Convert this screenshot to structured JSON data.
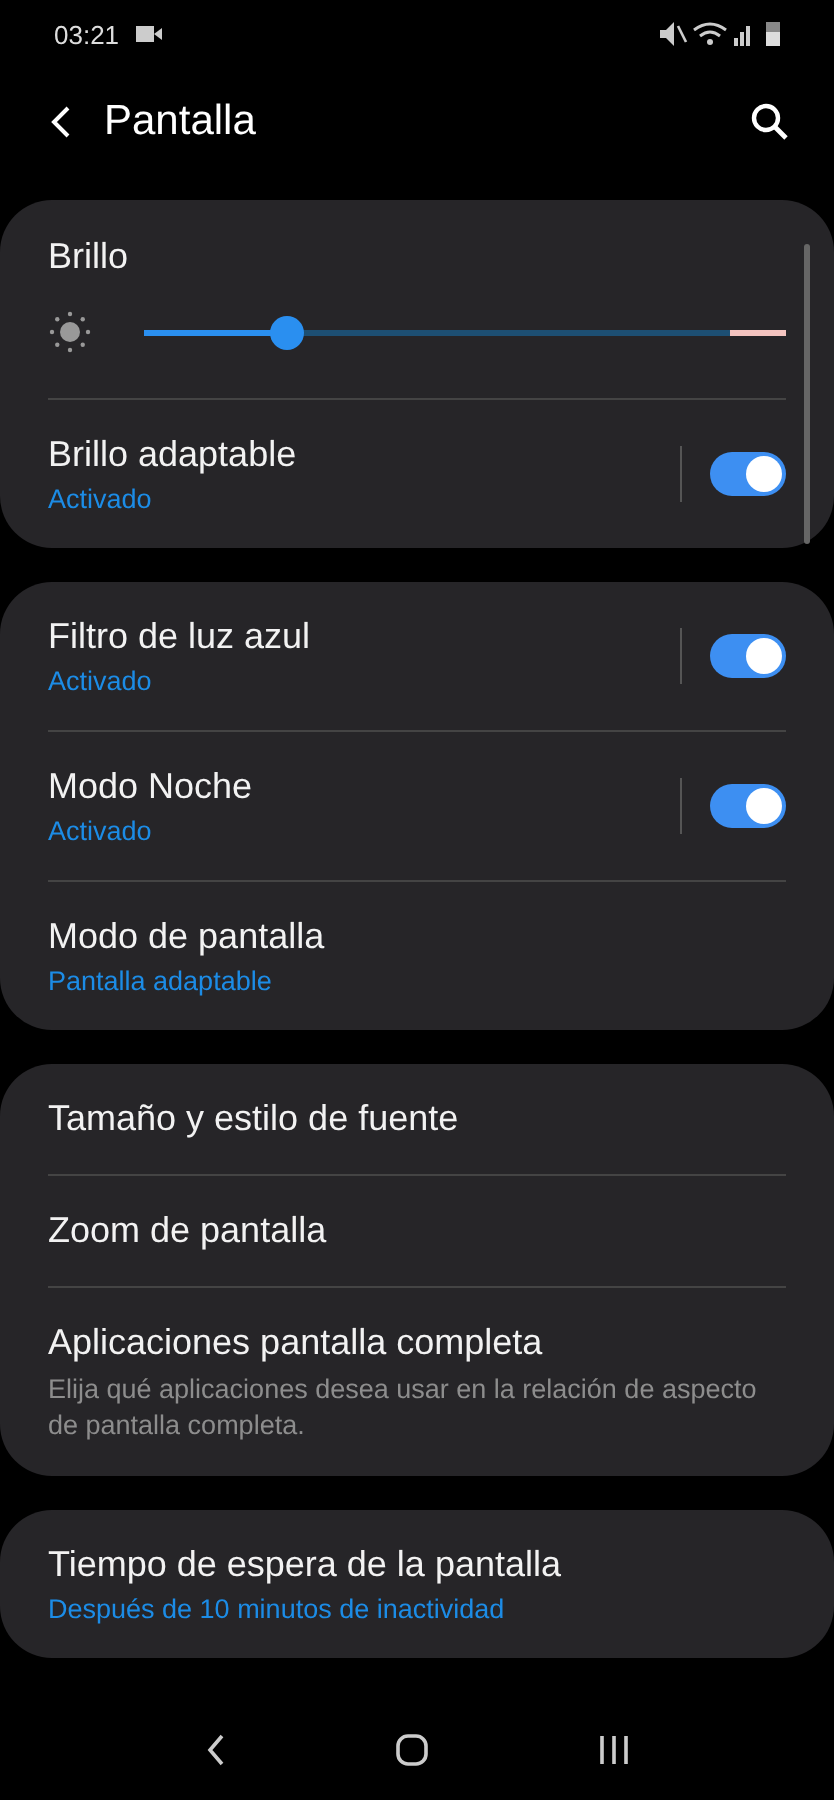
{
  "status_bar": {
    "time": "03:21"
  },
  "header": {
    "title": "Pantalla"
  },
  "groups": [
    {
      "items": [
        {
          "kind": "slider",
          "title": "Brillo",
          "level": 0.22
        },
        {
          "kind": "toggle",
          "title": "Brillo adaptable",
          "summary": "Activado",
          "on": true
        }
      ]
    },
    {
      "items": [
        {
          "kind": "toggle",
          "title": "Filtro de luz azul",
          "summary": "Activado",
          "on": true
        },
        {
          "kind": "toggle",
          "title": "Modo Noche",
          "summary": "Activado",
          "on": true
        },
        {
          "kind": "link",
          "title": "Modo de pantalla",
          "summary": "Pantalla adaptable"
        }
      ]
    },
    {
      "items": [
        {
          "kind": "link",
          "title": "Tamaño y estilo de fuente"
        },
        {
          "kind": "link",
          "title": "Zoom de pantalla"
        },
        {
          "kind": "link",
          "title": "Aplicaciones pantalla completa",
          "description": "Elija qué aplicaciones desea usar en la relación de aspecto de pantalla completa."
        }
      ]
    },
    {
      "items": [
        {
          "kind": "link",
          "title": "Tiempo de espera de la pantalla",
          "summary": "Después de 10 minutos de inactividad"
        }
      ]
    }
  ]
}
